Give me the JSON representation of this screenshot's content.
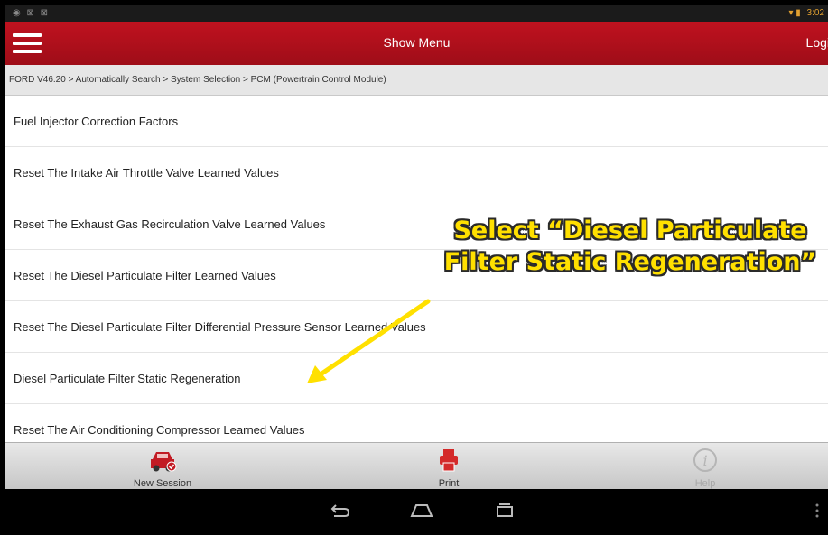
{
  "status_bar": {
    "left_icons": "◉ ⊠ ⊠",
    "time": "3:02"
  },
  "app_bar": {
    "title": "Show Menu",
    "login_label": "Logi"
  },
  "breadcrumb": "FORD V46.20 > Automatically Search > System Selection > PCM (Powertrain Control Module)",
  "menu_items": [
    "Fuel Injector Correction Factors",
    "Reset The Intake Air Throttle Valve Learned Values",
    "Reset The Exhaust Gas Recirculation Valve Learned Values",
    "Reset The Diesel Particulate Filter Learned Values",
    "Reset The Diesel Particulate Filter Differential Pressure Sensor Learned Values",
    "Diesel Particulate Filter Static Regeneration",
    "Reset The Air Conditioning Compressor Learned Values"
  ],
  "annotation": {
    "line1": "Select “Diesel Particulate",
    "line2": "Filter Static Regeneration”",
    "color": "#ffe000"
  },
  "toolbar": {
    "new_session": {
      "label": "New Session",
      "icon": "car-icon"
    },
    "print": {
      "label": "Print",
      "icon": "printer-icon"
    },
    "help": {
      "label": "Help",
      "icon": "info-icon"
    }
  },
  "colors": {
    "brand_red": "#b3101c",
    "annotation_yellow": "#ffe000"
  }
}
